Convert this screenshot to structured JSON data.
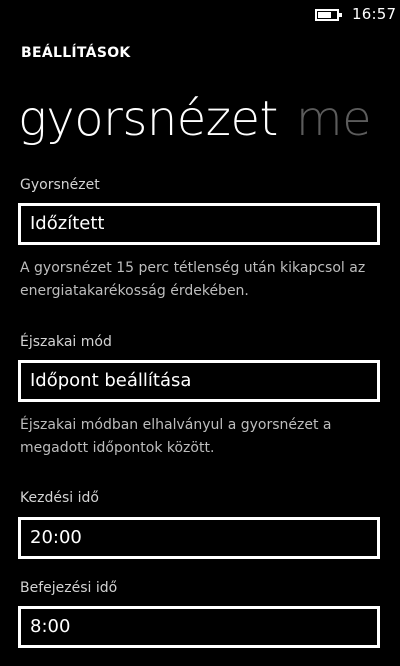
{
  "status": {
    "time": "16:57",
    "battery_icon": "battery-icon"
  },
  "app": {
    "title": "BEÁLLÍTÁSOK"
  },
  "pivot": {
    "active": "gyorsnézet",
    "next": "me"
  },
  "quickview": {
    "label": "Gyorsnézet",
    "value": "Időzített",
    "help": "A gyorsnézet 15 perc tétlenség után kikapcsol az energiatakarékosság érdekében."
  },
  "night_mode": {
    "label": "Éjszakai mód",
    "value": "Időpont beállítása",
    "help": "Éjszakai módban elhalványul a gyorsnézet a megadott időpontok között."
  },
  "start_time": {
    "label": "Kezdési idő",
    "value": "20:00"
  },
  "end_time": {
    "label": "Befejezési idő",
    "value": "8:00"
  }
}
